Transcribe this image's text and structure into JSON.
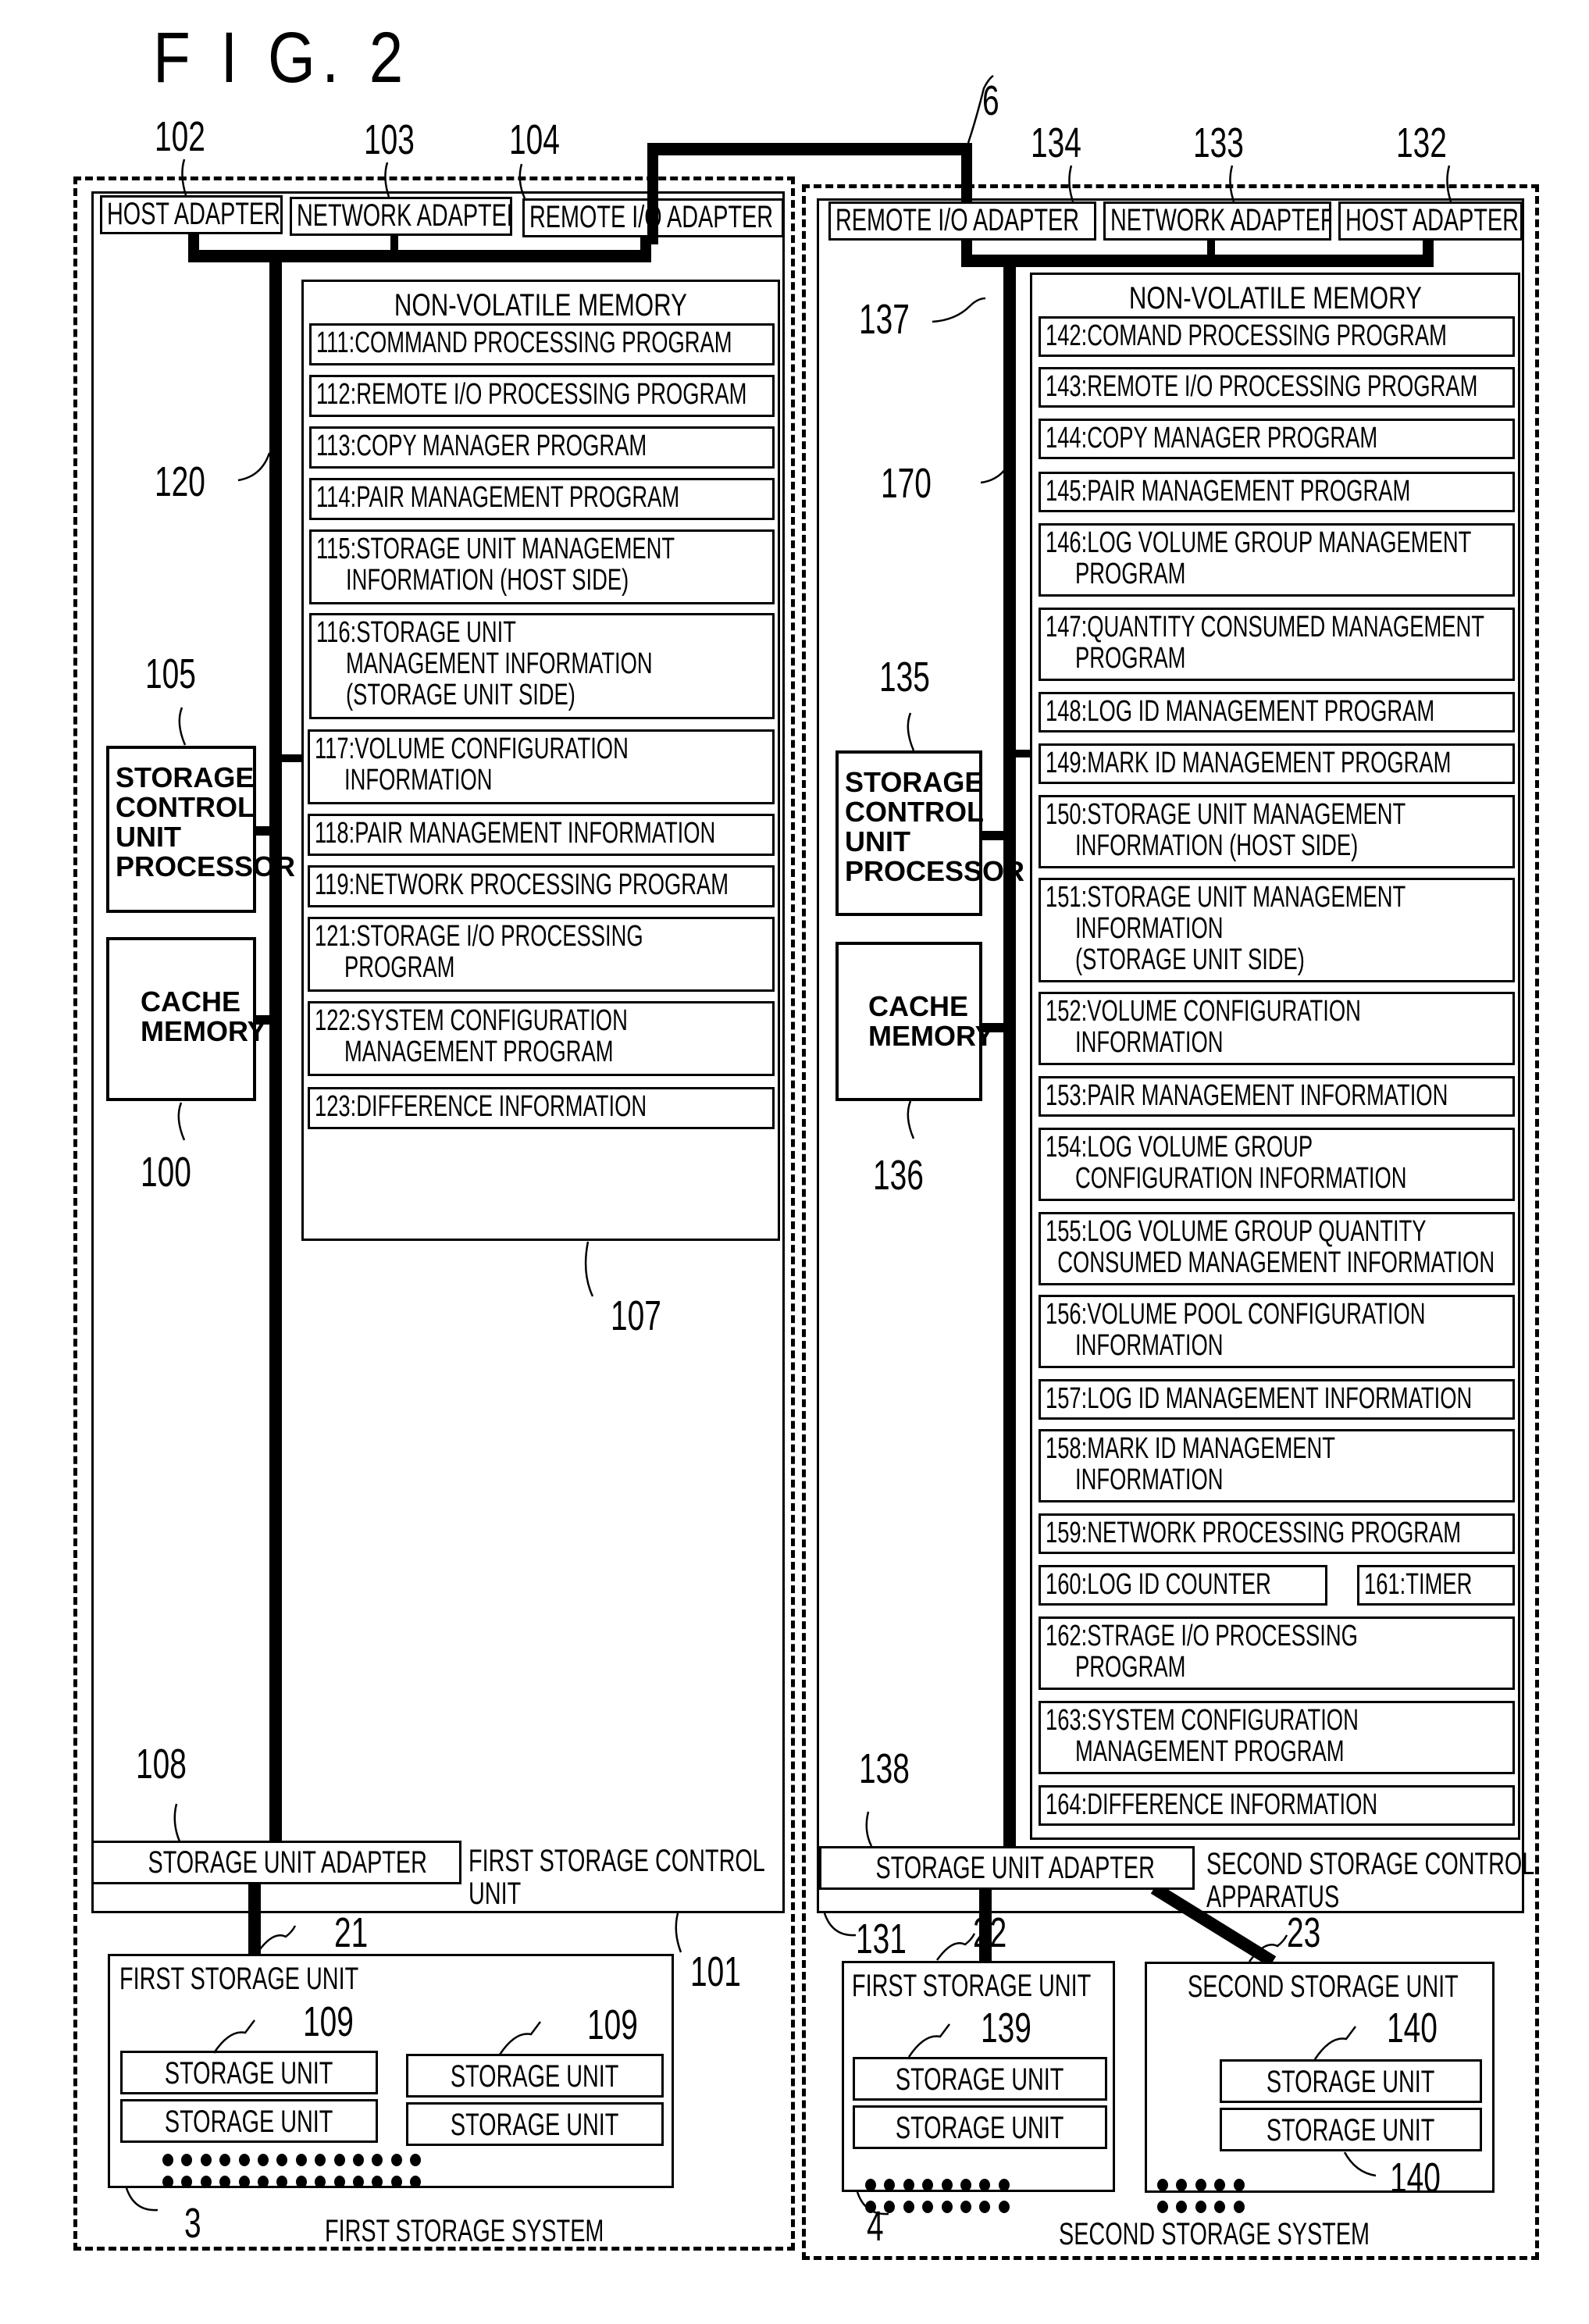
{
  "figure": {
    "title": "F I G. 2"
  },
  "refs": {
    "r102": "102",
    "r103": "103",
    "r104": "104",
    "r6": "6",
    "r134": "134",
    "r133": "133",
    "r132": "132",
    "r120": "120",
    "r105": "105",
    "r100": "100",
    "r107": "107",
    "r108": "108",
    "r21": "21",
    "r109a": "109",
    "r109b": "109",
    "r101": "101",
    "r3": "3",
    "r137": "137",
    "r170": "170",
    "r135": "135",
    "r136": "136",
    "r138": "138",
    "r131": "131",
    "r22": "22",
    "r23": "23",
    "r139": "139",
    "r140a": "140",
    "r140b": "140",
    "r4": "4"
  },
  "left": {
    "adapters": [
      "HOST ADAPTER",
      "NETWORK ADAPTER",
      "REMOTE I/O ADAPTER"
    ],
    "nvm_title": "NON-VOLATILE MEMORY",
    "nvm_items": [
      "111:COMMAND PROCESSING PROGRAM",
      "112:REMOTE I/O PROCESSING PROGRAM",
      "113:COPY MANAGER PROGRAM",
      "114:PAIR MANAGEMENT PROGRAM",
      "115:STORAGE UNIT MANAGEMENT\n     INFORMATION (HOST SIDE)",
      "116:STORAGE UNIT\n     MANAGEMENT INFORMATION\n     (STORAGE UNIT SIDE)",
      "117:VOLUME CONFIGURATION\n     INFORMATION",
      "118:PAIR MANAGEMENT INFORMATION",
      "119:NETWORK PROCESSING PROGRAM",
      "121:STORAGE I/O PROCESSING\n     PROGRAM",
      "122:SYSTEM CONFIGURATION\n     MANAGEMENT PROGRAM",
      "123:DIFFERENCE INFORMATION"
    ],
    "processor": "STORAGE\nCONTROL\nUNIT\nPROCESSOR",
    "cache": "CACHE\nMEMORY",
    "storage_unit_adapter": "STORAGE UNIT ADAPTER",
    "control_unit_label": "FIRST STORAGE CONTROL\nUNIT",
    "first_storage_unit": "FIRST STORAGE UNIT",
    "storage_units": [
      "STORAGE UNIT",
      "STORAGE UNIT",
      "STORAGE UNIT",
      "STORAGE UNIT"
    ],
    "system_label": "FIRST STORAGE SYSTEM"
  },
  "right": {
    "adapters": [
      "REMOTE I/O ADAPTER",
      "NETWORK ADAPTER",
      "HOST ADAPTER"
    ],
    "nvm_title": "NON-VOLATILE MEMORY",
    "nvm_items": [
      "142:COMAND PROCESSING PROGRAM",
      "143:REMOTE I/O PROCESSING PROGRAM",
      "144:COPY MANAGER PROGRAM",
      "145:PAIR MANAGEMENT PROGRAM",
      "146:LOG VOLUME GROUP MANAGEMENT\n     PROGRAM",
      "147:QUANTITY CONSUMED MANAGEMENT\n     PROGRAM",
      "148:LOG ID MANAGEMENT PROGRAM",
      "149:MARK ID MANAGEMENT PROGRAM",
      "150:STORAGE UNIT MANAGEMENT\n     INFORMATION (HOST SIDE)",
      "151:STORAGE UNIT MANAGEMENT\n     INFORMATION\n     (STORAGE UNIT SIDE)",
      "152:VOLUME CONFIGURATION\n     INFORMATION",
      "153:PAIR MANAGEMENT INFORMATION",
      "154:LOG VOLUME GROUP\n     CONFIGURATION INFORMATION",
      "155:LOG VOLUME GROUP QUANTITY\n  CONSUMED MANAGEMENT INFORMATION",
      "156:VOLUME POOL CONFIGURATION\n     INFORMATION",
      "157:LOG ID MANAGEMENT INFORMATION",
      "158:MARK ID MANAGEMENT\n     INFORMATION",
      "159:NETWORK PROCESSING PROGRAM",
      "160:LOG ID COUNTER",
      "161:TIMER",
      "162:STRAGE I/O PROCESSING\n     PROGRAM",
      "163:SYSTEM CONFIGURATION\n     MANAGEMENT PROGRAM",
      "164:DIFFERENCE INFORMATION"
    ],
    "processor": "STORAGE\nCONTROL\nUNIT\nPROCESSOR",
    "cache": "CACHE\nMEMORY",
    "storage_unit_adapter": "STORAGE UNIT ADAPTER",
    "control_unit_label": "SECOND STORAGE CONTROL\nAPPARATUS",
    "first_storage_unit": "FIRST STORAGE UNIT",
    "second_storage_unit": "SECOND STORAGE UNIT",
    "first_units": [
      "STORAGE UNIT",
      "STORAGE UNIT"
    ],
    "second_units": [
      "STORAGE UNIT",
      "STORAGE UNIT"
    ],
    "system_label": "SECOND STORAGE SYSTEM"
  }
}
